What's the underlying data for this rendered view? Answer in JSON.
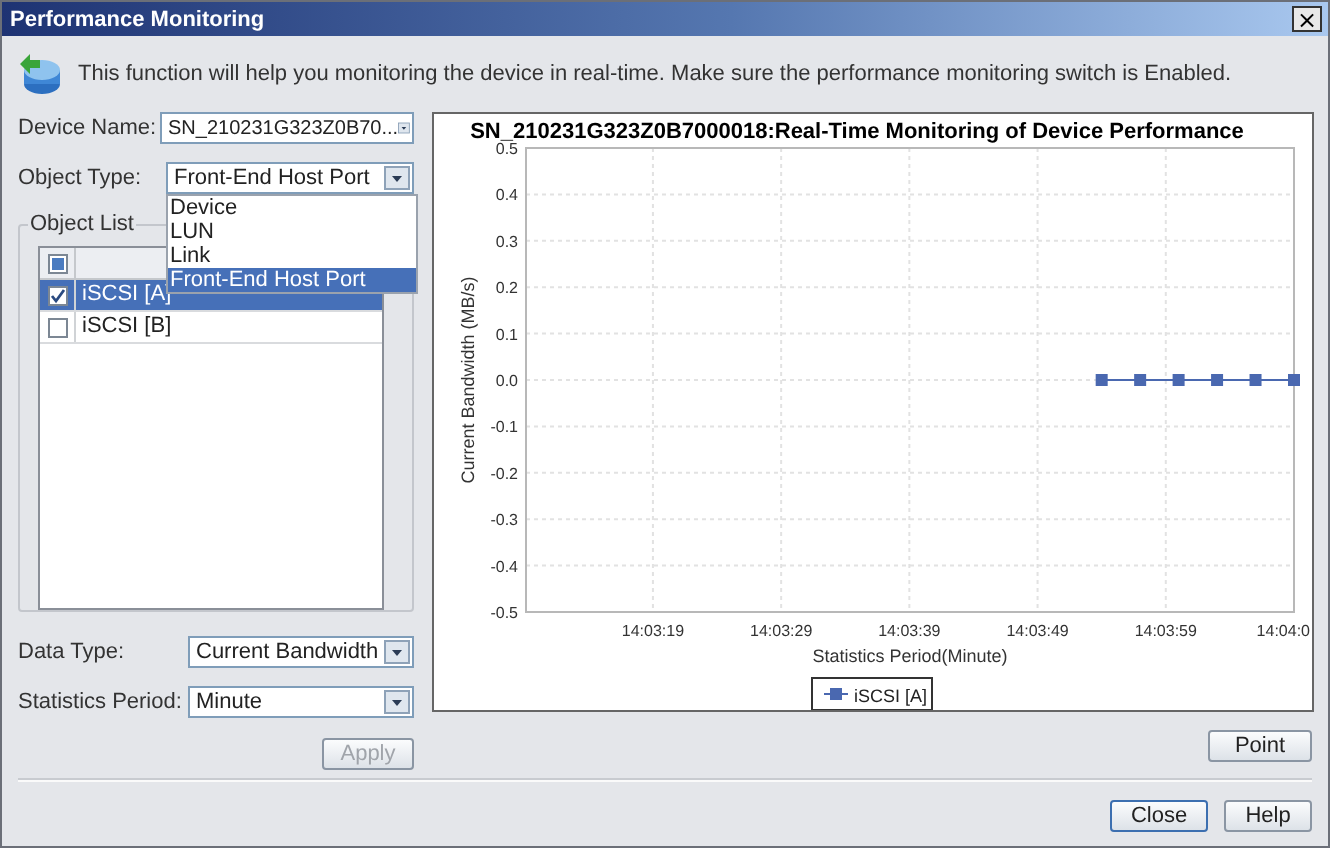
{
  "window": {
    "title": "Performance Monitoring",
    "close_glyph": "×"
  },
  "intro": "This function will help you monitoring the device in real-time. Make sure the performance monitoring switch is Enabled.",
  "device_name": {
    "label": "Device Name:",
    "value": "SN_210231G323Z0B70..."
  },
  "object_type": {
    "label": "Object Type:",
    "value": "Front-End Host Port",
    "expanded": true,
    "options": [
      {
        "label": "Device",
        "selected": false
      },
      {
        "label": "LUN",
        "selected": false
      },
      {
        "label": "Link",
        "selected": false
      },
      {
        "label": "Front-End Host Port",
        "selected": true
      }
    ]
  },
  "object_list": {
    "title": "Object List",
    "select_all_indeterminate": true,
    "rows": [
      {
        "label": "iSCSI [A]",
        "checked": true,
        "selected": true
      },
      {
        "label": "iSCSI [B]",
        "checked": false,
        "selected": false
      }
    ]
  },
  "data_type": {
    "label": "Data Type:",
    "value": "Current Bandwidth"
  },
  "statistics_period": {
    "label": "Statistics Period:",
    "value": "Minute"
  },
  "apply_button": {
    "label": "Apply",
    "disabled": true
  },
  "chart": {
    "chart_data": {
      "type": "line",
      "title": "SN_210231G323Z0B7000018:Real-Time Monitoring of Device Performance",
      "xlabel": "Statistics Period(Minute)",
      "ylabel": "Current Bandwidth (MB/s)",
      "categories": [
        null,
        null,
        null,
        null,
        null,
        null,
        null,
        null,
        null,
        "14:03:19",
        null,
        null,
        null,
        null,
        null,
        null,
        null,
        null,
        null,
        "14:03:29",
        null,
        null,
        null,
        null,
        null,
        null,
        null,
        null,
        null,
        "14:03:39",
        null,
        null,
        null,
        null,
        null,
        null,
        null,
        null,
        null,
        "14:03:49",
        null,
        null,
        null,
        null,
        null,
        null,
        null,
        null,
        null,
        "14:03:59",
        null,
        null,
        null,
        null,
        null,
        null,
        null,
        null,
        null,
        "14:04:0"
      ],
      "series": [
        {
          "name": "iSCSI [A]",
          "color": "#4a68b0",
          "marker": "square",
          "values": [
            null,
            null,
            null,
            null,
            null,
            null,
            null,
            null,
            null,
            null,
            null,
            null,
            null,
            null,
            null,
            null,
            null,
            null,
            null,
            null,
            null,
            null,
            null,
            null,
            null,
            null,
            null,
            null,
            null,
            null,
            null,
            null,
            null,
            null,
            null,
            null,
            null,
            null,
            null,
            null,
            null,
            null,
            null,
            null,
            0,
            null,
            null,
            0,
            null,
            null,
            0,
            null,
            null,
            0,
            null,
            null,
            0,
            null,
            null,
            0
          ]
        }
      ],
      "ylim": [
        -0.5,
        0.5
      ],
      "grid": true,
      "yticks": [
        {
          "value": 0.5,
          "label": "0.5"
        },
        {
          "value": 0.4,
          "label": "0.4"
        },
        {
          "value": 0.3,
          "label": "0.3"
        },
        {
          "value": 0.2,
          "label": "0.2"
        },
        {
          "value": 0.1,
          "label": "0.1"
        },
        {
          "value": 0,
          "label": "0.0"
        },
        {
          "value": -0.1,
          "label": "-0.1"
        },
        {
          "value": -0.2,
          "label": "-0.2"
        },
        {
          "value": -0.3,
          "label": "-0.3"
        },
        {
          "value": -0.4,
          "label": "-0.4"
        },
        {
          "value": -0.5,
          "label": "-0.5"
        }
      ]
    }
  },
  "point_button": {
    "label": "Point"
  },
  "buttons": [
    {
      "label": "Close",
      "focused": true
    },
    {
      "label": "Help",
      "focused": false
    }
  ]
}
